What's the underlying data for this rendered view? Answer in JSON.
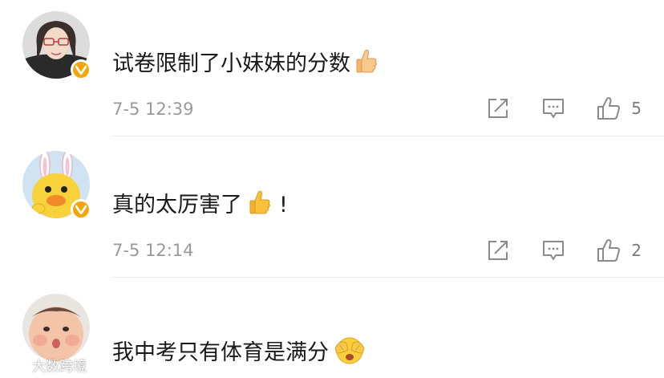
{
  "comments": [
    {
      "text": "试卷限制了小妹妹的分数",
      "emoji": "thumbs-up-icon",
      "time": "7-5 12:39",
      "likes": "5"
    },
    {
      "text": "真的太厉害了",
      "emoji": "thumbs-up-icon",
      "suffix": "!",
      "time": "7-5 12:14",
      "likes": "2"
    },
    {
      "text": "我中考只有体育是满分",
      "emoji": "covering-eyes-face-icon"
    }
  ],
  "colors": {
    "text": "#1a1a1a",
    "meta": "#9a9a9a",
    "icon": "#8a8a8a",
    "verified_badge": "#f4a50a"
  },
  "icons": [
    "share-icon",
    "comment-icon",
    "like-icon",
    "verified-icon"
  ],
  "watermark": {
    "text": "大数跨境"
  }
}
